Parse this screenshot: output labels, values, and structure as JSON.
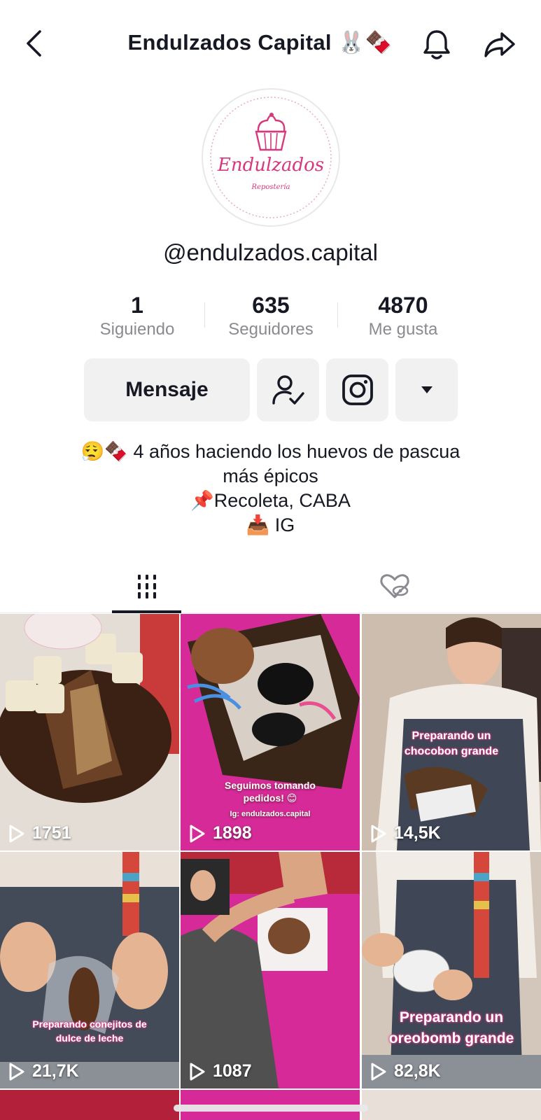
{
  "header": {
    "title": "Endulzados Capital 🐰🍫",
    "back_icon": "chevron-left-icon",
    "bell_icon": "bell-icon",
    "share_icon": "share-arrow-icon"
  },
  "avatar": {
    "brand_text": "Endulzados",
    "brand_subtext": "Repostería",
    "accent": "#d6397e"
  },
  "profile": {
    "username": "@endulzados.capital"
  },
  "stats": [
    {
      "value": "1",
      "label": "Siguiendo"
    },
    {
      "value": "635",
      "label": "Seguidores"
    },
    {
      "value": "4870",
      "label": "Me gusta"
    }
  ],
  "actions": {
    "message_label": "Mensaje",
    "follow_icon": "person-check-icon",
    "instagram_icon": "instagram-icon",
    "more_icon": "caret-down-icon"
  },
  "bio": {
    "line1": "😮‍💨🍫 4 años haciendo los huevos de pascua",
    "line2": "más épicos",
    "line3": "📌Recoleta, CABA",
    "line4": "📥 IG"
  },
  "tabs": [
    {
      "icon": "grid-icon",
      "active": true
    },
    {
      "icon": "liked-hidden-icon",
      "active": false
    }
  ],
  "videos": [
    {
      "views": "1751",
      "caption": ""
    },
    {
      "views": "1898",
      "caption": "Seguimos tomando pedidos! 😊",
      "caption2": "Ig: endulzados.capital"
    },
    {
      "views": "14,5K",
      "caption": "Preparando un chocobon grande"
    },
    {
      "views": "21,7K",
      "caption": "Preparando conejitos de dulce de leche"
    },
    {
      "views": "1087",
      "caption": ""
    },
    {
      "views": "82,8K",
      "caption": "Preparando un oreobomb grande"
    }
  ],
  "colors": {
    "text": "#161823",
    "muted": "#8a8b91",
    "button_bg": "#f1f1f2",
    "pink": "#e6358a"
  }
}
